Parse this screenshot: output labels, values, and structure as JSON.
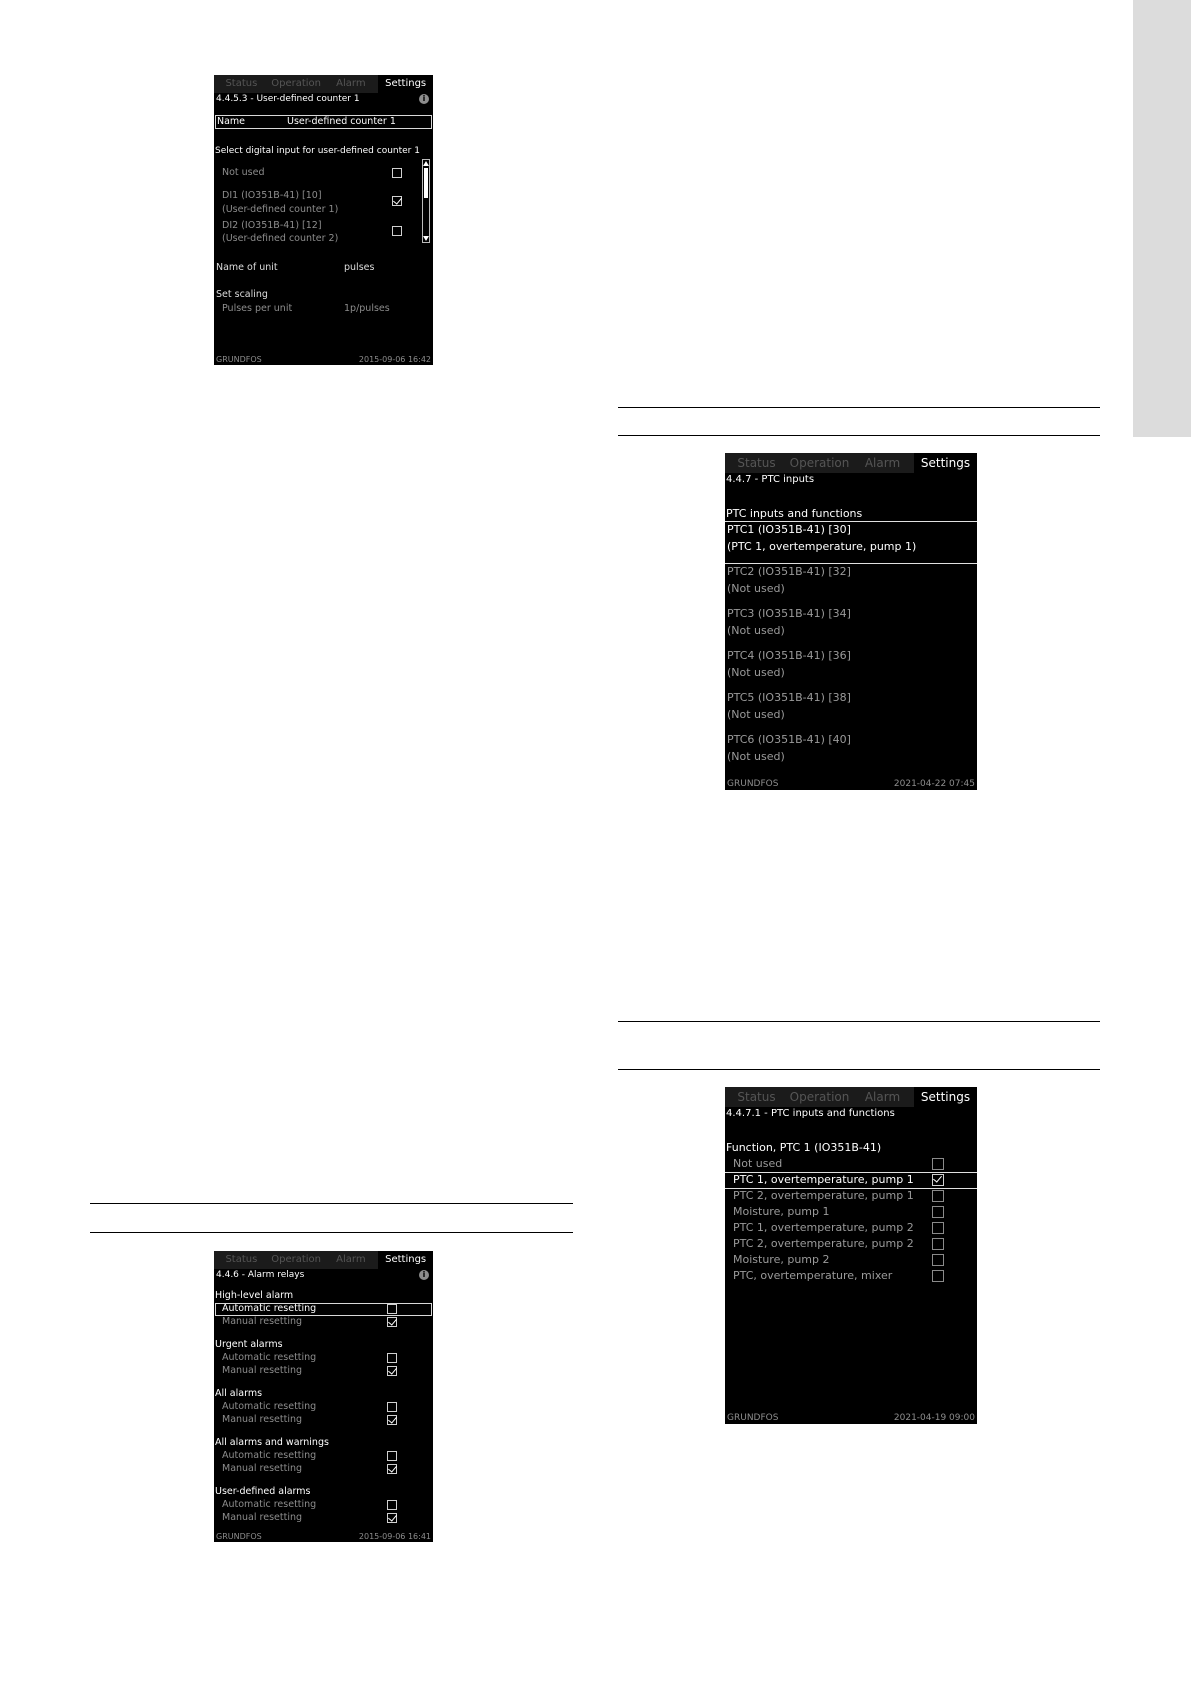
{
  "tabs": [
    "Status",
    "Operation",
    "Alarm",
    "Settings"
  ],
  "screen1": {
    "title": "4.4.5.3 - User-defined counter 1",
    "name_label": "Name",
    "name_value": "User-defined counter 1",
    "select_label": "Select digital input for user-defined counter 1",
    "options": [
      {
        "line1": "Not used",
        "line2": "",
        "checked": false
      },
      {
        "line1": "DI1 (IO351B-41) [10]",
        "line2": "(User-defined counter 1)",
        "checked": true
      },
      {
        "line1": "DI2 (IO351B-41) [12]",
        "line2": "(User-defined counter 2)",
        "checked": false
      }
    ],
    "unit_label": "Name of unit",
    "unit_value": "pulses",
    "scaling_label": "Set scaling",
    "ppu_label": "Pulses per unit",
    "ppu_value": "1p/pulses",
    "brand": "GRUNDFOS",
    "datetime": "2015-09-06  16:42"
  },
  "screen2": {
    "title": "4.4.7 - PTC inputs",
    "section_label": "PTC inputs and functions",
    "items": [
      {
        "line1": "PTC1 (IO351B-41) [30]",
        "line2": "(PTC 1, overtemperature, pump 1)"
      },
      {
        "line1": "PTC2 (IO351B-41) [32]",
        "line2": "(Not used)"
      },
      {
        "line1": "PTC3 (IO351B-41) [34]",
        "line2": "(Not used)"
      },
      {
        "line1": "PTC4 (IO351B-41) [36]",
        "line2": "(Not used)"
      },
      {
        "line1": "PTC5 (IO351B-41) [38]",
        "line2": "(Not used)"
      },
      {
        "line1": "PTC6 (IO351B-41) [40]",
        "line2": "(Not used)"
      }
    ],
    "brand": "GRUNDFOS",
    "datetime": "2021-04-22  07:45"
  },
  "screen3": {
    "title": "4.4.7.1 - PTC inputs and functions",
    "section_label": "Function, PTC 1 (IO351B-41)",
    "items": [
      {
        "label": "Not used",
        "checked": false
      },
      {
        "label": "PTC 1, overtemperature, pump 1",
        "checked": true
      },
      {
        "label": "PTC 2, overtemperature, pump 1",
        "checked": false
      },
      {
        "label": "Moisture, pump 1",
        "checked": false
      },
      {
        "label": "PTC 1, overtemperature, pump 2",
        "checked": false
      },
      {
        "label": "PTC 2, overtemperature, pump 2",
        "checked": false
      },
      {
        "label": "Moisture, pump 2",
        "checked": false
      },
      {
        "label": "PTC, overtemperature, mixer",
        "checked": false
      }
    ],
    "brand": "GRUNDFOS",
    "datetime": "2021-04-19  09:00"
  },
  "screen4": {
    "title": "4.4.6 - Alarm relays",
    "groups": [
      {
        "label": "High-level alarm",
        "auto": "Automatic resetting",
        "manual": "Manual resetting"
      },
      {
        "label": "Urgent alarms",
        "auto": "Automatic resetting",
        "manual": "Manual resetting"
      },
      {
        "label": "All alarms",
        "auto": "Automatic resetting",
        "manual": "Manual resetting"
      },
      {
        "label": "All alarms and warnings",
        "auto": "Automatic resetting",
        "manual": "Manual resetting"
      },
      {
        "label": "User-defined alarms",
        "auto": "Automatic resetting",
        "manual": "Manual resetting"
      }
    ],
    "brand": "GRUNDFOS",
    "datetime": "2015-09-06  16:41"
  }
}
